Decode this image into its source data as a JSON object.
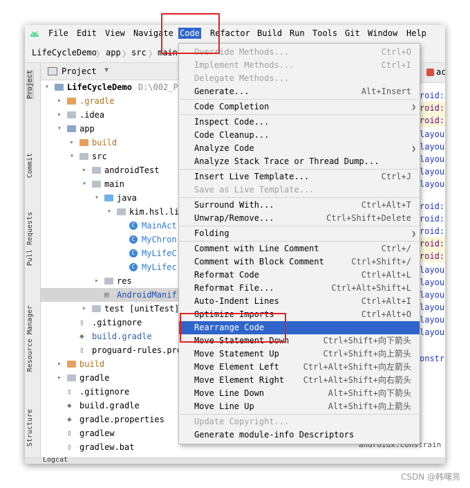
{
  "menubar": {
    "items": [
      "File",
      "Edit",
      "View",
      "Navigate",
      "Code",
      "Refactor",
      "Build",
      "Run",
      "Tools",
      "Git",
      "Window",
      "Help"
    ],
    "active": "Code"
  },
  "breadcrumb": [
    "LifeCycleDemo",
    "app",
    "src",
    "main"
  ],
  "left_tabs": [
    "Project",
    "Commit",
    "Pull Requests",
    "Resource Manager",
    "Structure"
  ],
  "project_panel": {
    "title": "Project",
    "tree": [
      {
        "label": "LifeCycleDemo",
        "extra": "D:\\002_P",
        "icon": "module-icon",
        "arrow": "v"
      },
      {
        "label": ".gradle",
        "icon": "folder-orange-icon",
        "arrow": ">"
      },
      {
        "label": ".idea",
        "icon": "folder-icon",
        "arrow": ">"
      },
      {
        "label": "app",
        "icon": "module-folder-icon",
        "arrow": "v"
      },
      {
        "label": "build",
        "icon": "folder-orange-icon",
        "arrow": ">"
      },
      {
        "label": "src",
        "icon": "folder-icon",
        "arrow": "v"
      },
      {
        "label": "androidTest",
        "icon": "folder-icon",
        "arrow": ">"
      },
      {
        "label": "main",
        "icon": "folder-icon",
        "arrow": "v"
      },
      {
        "label": "java",
        "icon": "folder-blue-icon",
        "arrow": "v"
      },
      {
        "label": "kim.hsl.li",
        "icon": "package-icon",
        "arrow": "v"
      },
      {
        "label": "MainAct",
        "icon": "class-icon",
        "arrow": ""
      },
      {
        "label": "MyChron",
        "icon": "class-icon",
        "arrow": ""
      },
      {
        "label": "MyLifeC",
        "icon": "class-icon",
        "arrow": ""
      },
      {
        "label": "MyLifec",
        "icon": "class-icon",
        "arrow": ""
      },
      {
        "label": "res",
        "icon": "res-folder-icon",
        "arrow": ">"
      },
      {
        "label": "AndroidManif",
        "icon": "manifest-icon",
        "arrow": ""
      },
      {
        "label": "test [unitTest]",
        "icon": "folder-icon",
        "arrow": ">"
      },
      {
        "label": ".gitignore",
        "icon": "file-icon",
        "arrow": ""
      },
      {
        "label": "build.gradle",
        "icon": "gradle-icon",
        "arrow": ""
      },
      {
        "label": "proguard-rules.pro",
        "icon": "file-icon",
        "arrow": ""
      },
      {
        "label": "build",
        "icon": "folder-orange-icon",
        "arrow": ">"
      },
      {
        "label": "gradle",
        "icon": "folder-icon",
        "arrow": ">"
      },
      {
        "label": ".gitignore",
        "icon": "file-icon",
        "arrow": ""
      },
      {
        "label": "build.gradle",
        "icon": "gradle-icon",
        "arrow": ""
      },
      {
        "label": "gradle.properties",
        "icon": "gradle-icon",
        "arrow": ""
      },
      {
        "label": "gradlew",
        "icon": "file-icon",
        "arrow": ""
      },
      {
        "label": "gradlew.bat",
        "icon": "file-icon",
        "arrow": ""
      }
    ]
  },
  "editor": {
    "tab_label": "ac",
    "lines": [
      "roid:l",
      "roid:t",
      "roid:c",
      "layou",
      "layou",
      "layou",
      "layou",
      "layou",
      "roid:i",
      "roid:l",
      "roid:l",
      "roid:t",
      "roid:c",
      "layou",
      "layou",
      "layou",
      "layou",
      "layou",
      "layou",
      "onstr"
    ],
    "footer": "androidx.constrain"
  },
  "bottom_label": "Logcat",
  "code_menu": {
    "groups": [
      [
        {
          "label": "Override Methods...",
          "shortcut": "Ctrl+O",
          "disabled": true
        },
        {
          "label": "Implement Methods...",
          "shortcut": "Ctrl+I",
          "disabled": true
        },
        {
          "label": "Delegate Methods...",
          "shortcut": "",
          "disabled": true
        },
        {
          "label": "Generate...",
          "shortcut": "Alt+Insert"
        }
      ],
      [
        {
          "label": "Code Completion",
          "shortcut": "",
          "submenu": true
        }
      ],
      [
        {
          "label": "Inspect Code...",
          "shortcut": ""
        },
        {
          "label": "Code Cleanup...",
          "shortcut": ""
        },
        {
          "label": "Analyze Code",
          "shortcut": "",
          "submenu": true
        },
        {
          "label": "Analyze Stack Trace or Thread Dump...",
          "shortcut": ""
        }
      ],
      [
        {
          "label": "Insert Live Template...",
          "shortcut": "Ctrl+J"
        },
        {
          "label": "Save as Live Template...",
          "shortcut": "",
          "disabled": true
        }
      ],
      [
        {
          "label": "Surround With...",
          "shortcut": "Ctrl+Alt+T"
        },
        {
          "label": "Unwrap/Remove...",
          "shortcut": "Ctrl+Shift+Delete"
        }
      ],
      [
        {
          "label": "Folding",
          "shortcut": "",
          "submenu": true
        }
      ],
      [
        {
          "label": "Comment with Line Comment",
          "shortcut": "Ctrl+/"
        },
        {
          "label": "Comment with Block Comment",
          "shortcut": "Ctrl+Shift+/"
        },
        {
          "label": "Reformat Code",
          "shortcut": "Ctrl+Alt+L"
        },
        {
          "label": "Reformat File...",
          "shortcut": "Ctrl+Alt+Shift+L"
        },
        {
          "label": "Auto-Indent Lines",
          "shortcut": "Ctrl+Alt+I"
        },
        {
          "label": "Optimize Imports",
          "shortcut": "Ctrl+Alt+O"
        },
        {
          "label": "Rearrange Code",
          "shortcut": "",
          "highlighted": true
        },
        {
          "label": "Move Statement Down",
          "shortcut": "Ctrl+Shift+向下箭头"
        },
        {
          "label": "Move Statement Up",
          "shortcut": "Ctrl+Shift+向上箭头"
        },
        {
          "label": "Move Element Left",
          "shortcut": "Ctrl+Alt+Shift+向左箭头"
        },
        {
          "label": "Move Element Right",
          "shortcut": "Ctrl+Alt+Shift+向右箭头"
        },
        {
          "label": "Move Line Down",
          "shortcut": "Alt+Shift+向下箭头"
        },
        {
          "label": "Move Line Up",
          "shortcut": "Alt+Shift+向上箭头"
        }
      ],
      [
        {
          "label": "Update Copyright...",
          "shortcut": "",
          "disabled": true
        },
        {
          "label": "Generate module-info Descriptors",
          "shortcut": ""
        }
      ]
    ]
  },
  "watermark": "CSDN @韩曙亮",
  "colors": {
    "accent": "#2f65ca",
    "highlight_box": "#e02020"
  }
}
